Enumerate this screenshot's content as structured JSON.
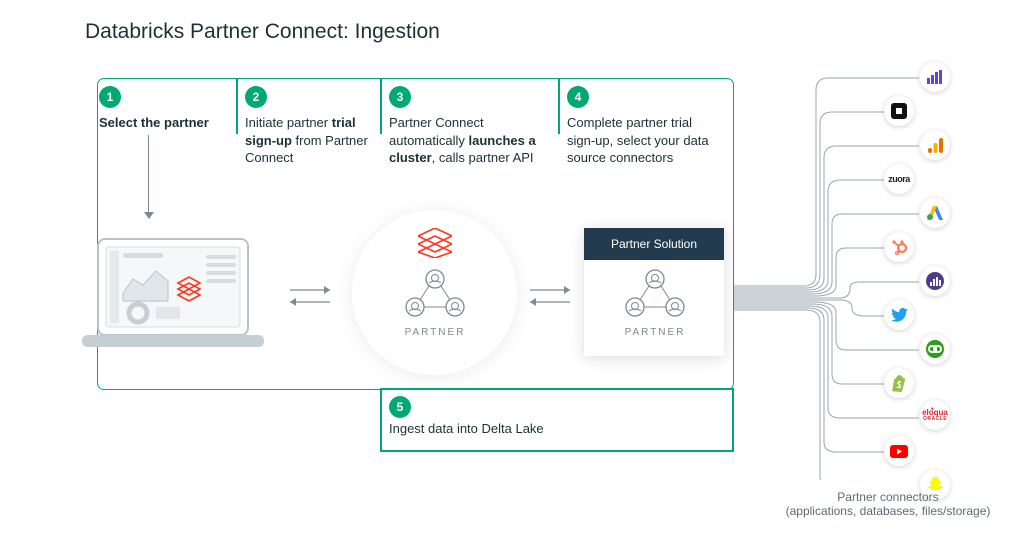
{
  "title": "Databricks Partner Connect: Ingestion",
  "steps": {
    "1": {
      "num": "1",
      "label": "Select the partner"
    },
    "2": {
      "num": "2",
      "t1": "Initiate partner",
      "bold": "trial sign-up",
      "t2": " from Partner Connect"
    },
    "3": {
      "num": "3",
      "t1": "Partner Connect automatically ",
      "bold": "launches a cluster",
      "t2": ", calls partner API"
    },
    "4": {
      "num": "4",
      "text": "Complete partner trial sign-up, select your data source connectors"
    },
    "5": {
      "num": "5",
      "text": "Ingest data into Delta Lake"
    }
  },
  "partner_label": "PARTNER",
  "partner_solution_header": "Partner Solution",
  "connectors_caption": "Partner connectors\n(applications, databases, files/storage)",
  "connector_icons": [
    "marketo",
    "square",
    "google-analytics",
    "zuora",
    "google-ads",
    "hubspot",
    "mixpanel",
    "twitter",
    "quickbooks",
    "shopify",
    "eloqua",
    "youtube",
    "snapchat"
  ]
}
